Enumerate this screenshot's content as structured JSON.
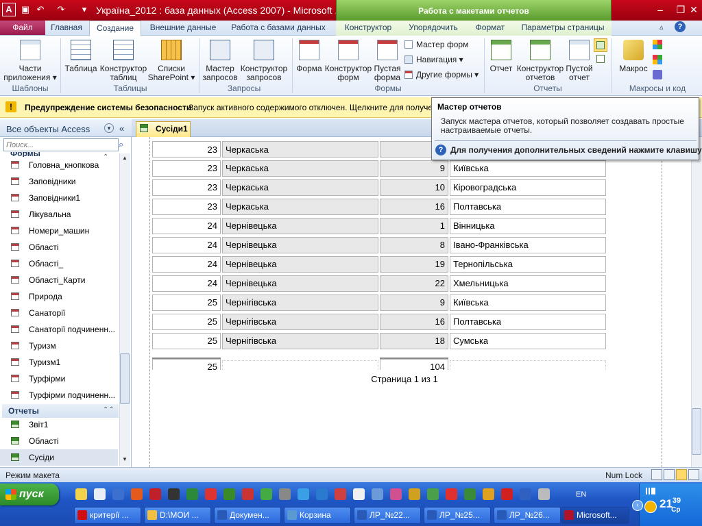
{
  "window": {
    "title": "Україна_2012 : база данных (Access 2007)  -  Microsoft ...",
    "context_tab_group": "Работа с макетами отчетов",
    "minimize": "–",
    "restore": "❐",
    "close": "✕"
  },
  "ribbon_tabs": {
    "file": "Файл",
    "home": "Главная",
    "create": "Создание",
    "external": "Внешние данные",
    "database": "Работа с базами данных",
    "designer": "Конструктор",
    "arrange": "Упорядочить",
    "format": "Формат",
    "page_setup": "Параметры страницы"
  },
  "ribbon": {
    "templates": {
      "parts": "Части\nприложения ▾",
      "group": "Шаблоны"
    },
    "tables": {
      "table": "Таблица",
      "table_design": "Конструктор\nтаблиц",
      "sharepoint": "Списки\nSharePoint ▾",
      "group": "Таблицы"
    },
    "queries": {
      "wizard": "Мастер\nзапросов",
      "design": "Конструктор\nзапросов",
      "group": "Запросы"
    },
    "forms": {
      "form": "Форма",
      "form_design": "Конструктор\nформ",
      "blank": "Пустая\nформа",
      "wizard": "Мастер форм",
      "navigation": "Навигация ▾",
      "more": "Другие формы ▾",
      "group": "Формы"
    },
    "reports": {
      "report": "Отчет",
      "report_design": "Конструктор\nотчетов",
      "blank": "Пустой\nотчет",
      "group": "Отчеты"
    },
    "macros": {
      "macro": "Макрос",
      "group": "Макросы и код"
    }
  },
  "security_bar": {
    "title": "Предупреждение системы безопасности",
    "text": "Запуск активного содержимого отключен. Щелкните для получения"
  },
  "tooltip": {
    "title": "Мастер отчетов",
    "description": "Запуск мастера отчетов, который позволяет создавать простые настраиваемые отчеты.",
    "help": "Для получения дополнительных сведений нажмите клавишу F1."
  },
  "nav_pane": {
    "title": "Все объекты Access",
    "search_placeholder": "Поиск...",
    "group_forms_partial": "Формы",
    "forms": [
      "Головна_кнопкова",
      "Заповідники",
      "Заповідники1",
      "Лікувальна",
      "Номери_машин",
      "Області",
      "Області_",
      "Області_Карти",
      "Природа",
      "Санаторії",
      "Санаторії подчиненн...",
      "Туризм",
      "Туризм1",
      "Турфірми",
      "Турфірми подчиненн..."
    ],
    "group_reports": "Отчеты",
    "reports": [
      "Звіт1",
      "Області",
      "Сусіди"
    ]
  },
  "document": {
    "tab_label": "Сусіди1",
    "rows": [
      {
        "id1": "23",
        "name1": "Черкаська",
        "id2": "",
        "name2": ""
      },
      {
        "id1": "23",
        "name1": "Черкаська",
        "id2": "9",
        "name2": "Київська"
      },
      {
        "id1": "23",
        "name1": "Черкаська",
        "id2": "10",
        "name2": "Кіровоградська"
      },
      {
        "id1": "23",
        "name1": "Черкаська",
        "id2": "16",
        "name2": "Полтавська"
      },
      {
        "id1": "24",
        "name1": "Чернівецька",
        "id2": "1",
        "name2": "Вінницька"
      },
      {
        "id1": "24",
        "name1": "Чернівецька",
        "id2": "8",
        "name2": "Івано-Франківська"
      },
      {
        "id1": "24",
        "name1": "Чернівецька",
        "id2": "19",
        "name2": "Тернопільська"
      },
      {
        "id1": "24",
        "name1": "Чернівецька",
        "id2": "22",
        "name2": "Хмельницька"
      },
      {
        "id1": "25",
        "name1": "Чернігівська",
        "id2": "9",
        "name2": "Київська"
      },
      {
        "id1": "25",
        "name1": "Чернігівська",
        "id2": "16",
        "name2": "Полтавська"
      },
      {
        "id1": "25",
        "name1": "Чернігівська",
        "id2": "18",
        "name2": "Сумська"
      }
    ],
    "total1": "25",
    "total2": "104",
    "page_text": "Страница 1 из 1"
  },
  "status_bar": {
    "mode": "Режим макета",
    "num_lock": "Num Lock"
  },
  "taskbar": {
    "start": "пуск",
    "lang": "EN",
    "clock": "21",
    "clock_min": "39",
    "clock_day": "Ср",
    "tasks": [
      "критерії ...",
      "D:\\МОИ ...",
      "Докумен...",
      "Корзина",
      "ЛР_№22...",
      "ЛР_№25...",
      "ЛР_№26...",
      "Microsoft..."
    ]
  },
  "colors": {
    "access_red": "#a00018",
    "context_green": "#5a9b2c",
    "security_yellow": "#fff5b0",
    "taskbar_blue": "#245edc",
    "start_green": "#3ea33a"
  }
}
